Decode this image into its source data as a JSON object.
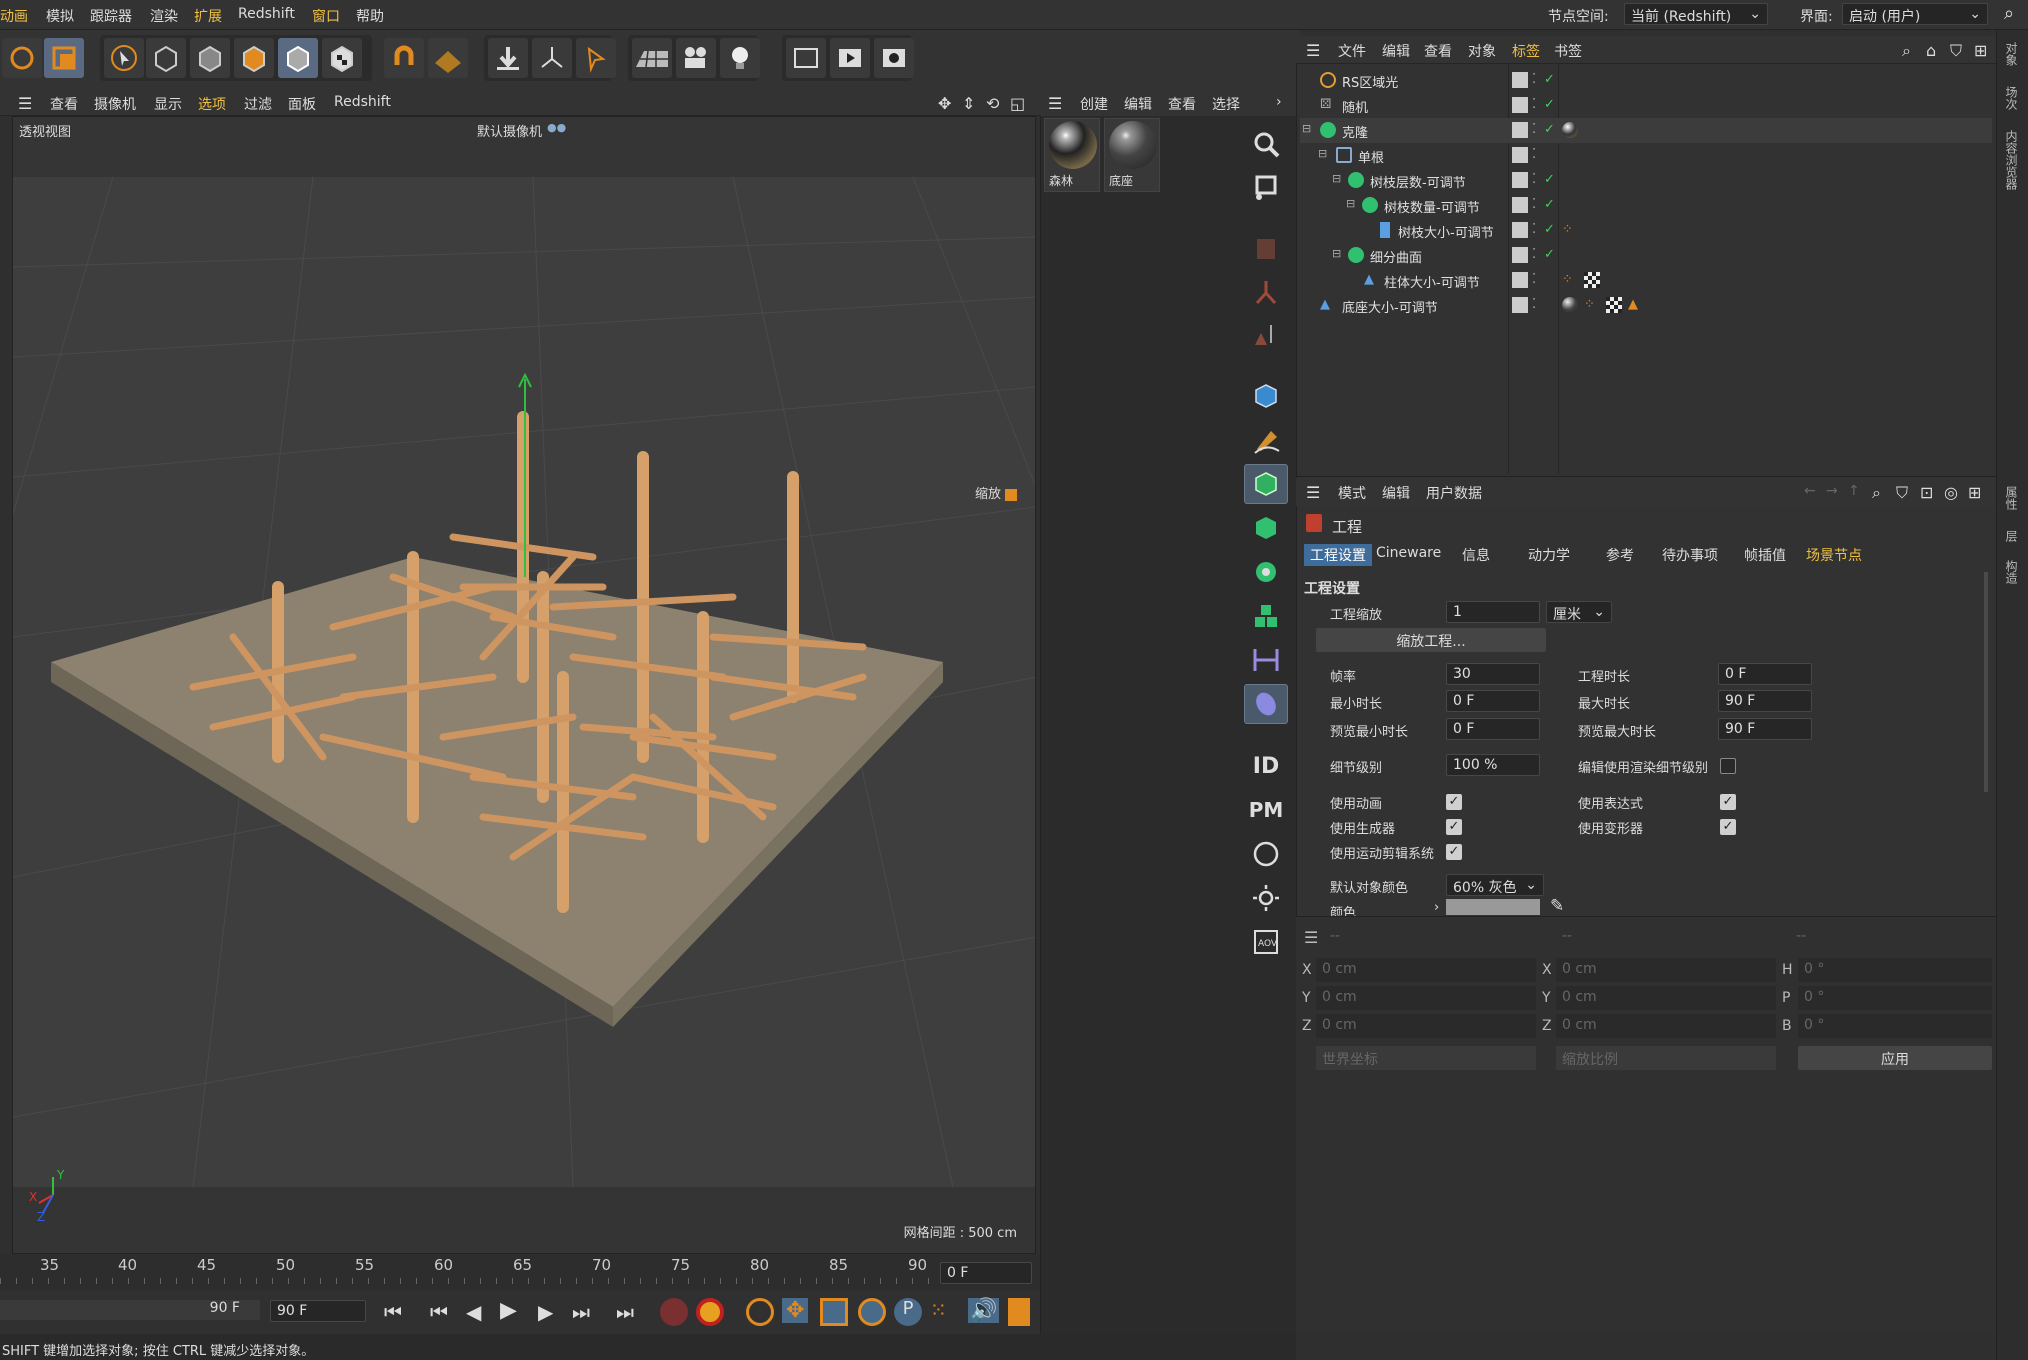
{
  "menubar": {
    "items": [
      "动画",
      "模拟",
      "跟踪器",
      "渲染",
      "扩展",
      "Redshift",
      "窗口",
      "帮助"
    ],
    "nodespace_label": "节点空间:",
    "nodespace_value": "当前 (Redshift)",
    "interface_label": "界面:",
    "interface_value": "启动 (用户)"
  },
  "viewport_menu": {
    "items": [
      "查看",
      "摄像机",
      "显示",
      "选项",
      "过滤",
      "面板",
      "Redshift"
    ]
  },
  "viewport": {
    "view_name": "透视视图",
    "camera": "默认摄像机",
    "zoom_label": "缩放",
    "grid_spacing": "网格间距 : 500 cm",
    "axis_x": "X",
    "axis_y": "Y",
    "axis_z": "Z"
  },
  "timeline": {
    "ticks": [
      "35",
      "40",
      "45",
      "50",
      "55",
      "60",
      "65",
      "70",
      "75",
      "80",
      "85",
      "90"
    ],
    "current_frame": "0 F"
  },
  "transport": {
    "end_frame_a": "90 F",
    "end_frame_b": "90 F"
  },
  "statusbar": {
    "text": "SHIFT 键增加选择对象; 按住 CTRL 键减少选择对象。"
  },
  "material_menu": {
    "items": [
      "创建",
      "编辑",
      "查看",
      "选择"
    ]
  },
  "materials": [
    {
      "name": "森林",
      "color": "#6b5a3a"
    },
    {
      "name": "底座",
      "color": "#666666"
    }
  ],
  "object_menu": {
    "items": [
      "文件",
      "编辑",
      "查看",
      "对象",
      "标签",
      "书签"
    ]
  },
  "objects": [
    {
      "name": "RS区域光",
      "indent": 0,
      "icon": "light-icon"
    },
    {
      "name": "随机",
      "indent": 0,
      "icon": "random-effector-icon"
    },
    {
      "name": "克隆",
      "indent": 0,
      "icon": "cloner-icon"
    },
    {
      "name": "单根",
      "indent": 1,
      "icon": "null-icon"
    },
    {
      "name": "树枝层数-可调节",
      "indent": 2,
      "icon": "cloner-icon"
    },
    {
      "name": "树枝数量-可调节",
      "indent": 3,
      "icon": "cloner-icon"
    },
    {
      "name": "树枝大小-可调节",
      "indent": 4,
      "icon": "cylinder-icon"
    },
    {
      "name": "细分曲面",
      "indent": 2,
      "icon": "subdivision-icon"
    },
    {
      "name": "柱体大小-可调节",
      "indent": 3,
      "icon": "cone-icon"
    },
    {
      "name": "底座大小-可调节",
      "indent": 0,
      "icon": "cube-icon"
    }
  ],
  "right_strip_tabs": [
    "对象",
    "场次",
    "内容浏览器",
    "属性",
    "层",
    "构造"
  ],
  "attributes": {
    "menu": [
      "模式",
      "编辑",
      "用户数据"
    ],
    "object_name": "工程",
    "tabs": [
      "工程设置",
      "Cineware",
      "信息",
      "动力学",
      "参考",
      "待办事项",
      "帧插值",
      "场景节点"
    ],
    "section": "工程设置",
    "project_scale_label": "工程缩放",
    "project_scale_value": "1",
    "unit": "厘米",
    "scale_button": "缩放工程...",
    "fps_label": "帧率",
    "fps": "30",
    "duration_label": "工程时长",
    "duration": "0 F",
    "min_time_label": "最小时长",
    "min_time": "0 F",
    "max_time_label": "最大时长",
    "max_time": "90 F",
    "pmin_label": "预览最小时长",
    "pmin": "0 F",
    "pmax_label": "预览最大时长",
    "pmax": "90 F",
    "lod_label": "细节级别",
    "lod": "100 %",
    "render_lod_label": "编辑使用渲染细节级别",
    "use_anim": "使用动画",
    "use_expr": "使用表达式",
    "use_gen": "使用生成器",
    "use_deform": "使用变形器",
    "use_motion": "使用运动剪辑系统",
    "default_color_label": "默认对象颜色",
    "default_color": "60% 灰色",
    "color_label": "颜色"
  },
  "coords": {
    "headers": [
      "--",
      "--",
      "--"
    ],
    "rows": [
      {
        "a": "X",
        "av": "0 cm",
        "b": "X",
        "bv": "0 cm",
        "c": "H",
        "cv": "0 °"
      },
      {
        "a": "Y",
        "av": "0 cm",
        "b": "Y",
        "bv": "0 cm",
        "c": "P",
        "cv": "0 °"
      },
      {
        "a": "Z",
        "av": "0 cm",
        "b": "Z",
        "bv": "0 cm",
        "c": "B",
        "cv": "0 °"
      }
    ],
    "world": "世界坐标",
    "scale": "缩放比例",
    "apply": "应用"
  }
}
